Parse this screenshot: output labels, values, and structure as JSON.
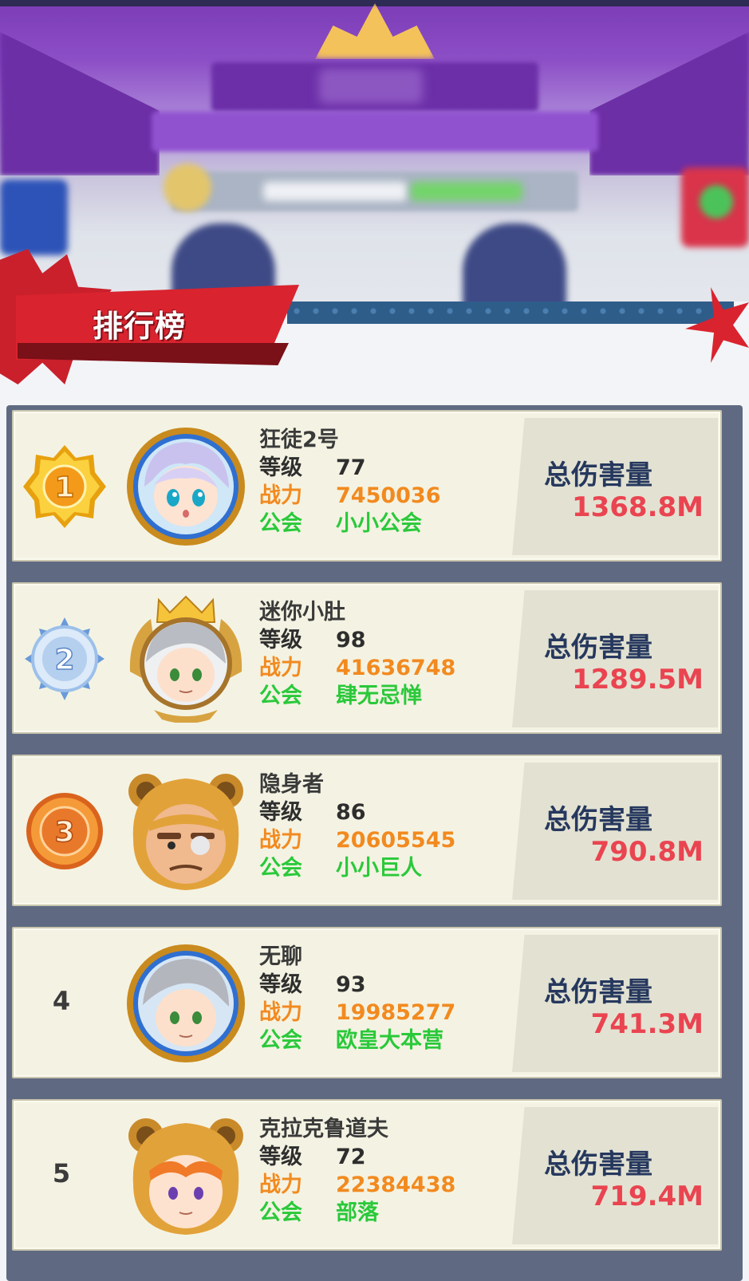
{
  "leaderboard": {
    "title": "排行榜",
    "labels": {
      "level": "等级",
      "power": "战力",
      "guild": "公会",
      "total_damage": "总伤害量"
    },
    "entries": [
      {
        "rank": "1",
        "name": "狂徒2号",
        "level": "77",
        "power": "7450036",
        "guild": "小小公会",
        "damage": "1368.8M",
        "medal_color": "#f2b51c",
        "avatar": "lilac-hair-girl"
      },
      {
        "rank": "2",
        "name": "迷你小肚",
        "level": "98",
        "power": "41636748",
        "guild": "肆无忌惮",
        "damage": "1289.5M",
        "medal_color": "#8fb6e6",
        "avatar": "silver-hair-crowned"
      },
      {
        "rank": "3",
        "name": "隐身者",
        "level": "86",
        "power": "20605545",
        "guild": "小小巨人",
        "damage": "790.8M",
        "medal_color": "#f08a2a",
        "avatar": "lion-hood-warrior"
      },
      {
        "rank": "4",
        "name": "无聊",
        "level": "93",
        "power": "19985277",
        "guild": "欧皇大本营",
        "damage": "741.3M",
        "avatar": "silver-hair"
      },
      {
        "rank": "5",
        "name": "克拉克鲁道夫",
        "level": "72",
        "power": "22384438",
        "guild": "部落",
        "damage": "719.4M",
        "avatar": "lion-hood-redhead"
      }
    ]
  }
}
